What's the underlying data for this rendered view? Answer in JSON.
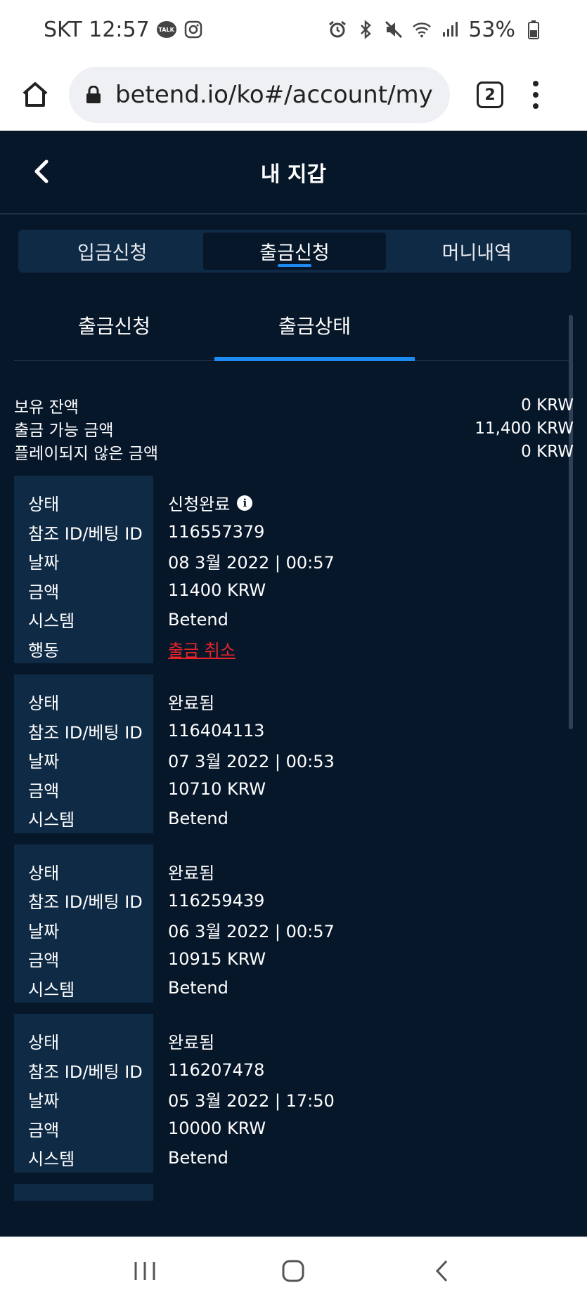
{
  "status_bar": {
    "carrier_time": "SKT 12:57",
    "battery": "53%",
    "talk_label": "TALK"
  },
  "browser": {
    "url": "betend.io/ko#/account/my-w",
    "tab_count": "2"
  },
  "header": {
    "title": "내 지갑"
  },
  "main_tabs": [
    {
      "label": "입금신청",
      "active": false
    },
    {
      "label": "출금신청",
      "active": true
    },
    {
      "label": "머니내역",
      "active": false
    }
  ],
  "sub_tabs": [
    {
      "label": "출금신청",
      "active": false
    },
    {
      "label": "출금상태",
      "active": true
    }
  ],
  "balances": [
    {
      "label": "보유 잔액",
      "value": "0 KRW"
    },
    {
      "label": "출금 가능 금액",
      "value": "11,400 KRW"
    },
    {
      "label": "플레이되지 않은 금액",
      "value": "0 KRW"
    }
  ],
  "labels": {
    "status": "상태",
    "ref_id": "참조 ID/베팅 ID",
    "date": "날짜",
    "amount": "금액",
    "system": "시스템",
    "action": "행동"
  },
  "records": [
    {
      "status": "신청완료",
      "ref_id": "116557379",
      "date": "08 3월 2022 | 00:57",
      "amount": "11400 KRW",
      "system": "Betend",
      "action": "출금 취소"
    },
    {
      "status": "완료됨",
      "ref_id": "116404113",
      "date": "07 3월 2022 | 00:53",
      "amount": "10710 KRW",
      "system": "Betend"
    },
    {
      "status": "완료됨",
      "ref_id": "116259439",
      "date": "06 3월 2022 | 00:57",
      "amount": "10915 KRW",
      "system": "Betend"
    },
    {
      "status": "완료됨",
      "ref_id": "116207478",
      "date": "05 3월 2022 | 17:50",
      "amount": "10000 KRW",
      "system": "Betend"
    }
  ],
  "icons": {
    "info": "i"
  },
  "colors": {
    "app_bg": "#07172a",
    "panel_bg": "#0f2a45",
    "accent": "#1d8cf2",
    "danger": "#e8242a"
  }
}
